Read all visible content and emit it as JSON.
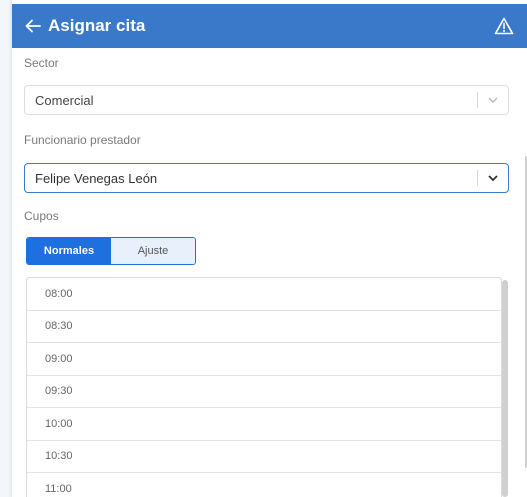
{
  "header": {
    "title": "Asignar cita"
  },
  "sector": {
    "label": "Sector",
    "value": "Comercial"
  },
  "funcionario": {
    "label": "Funcionario prestador",
    "value": "Felipe Venegas León"
  },
  "cupos": {
    "label": "Cupos",
    "tabs": [
      {
        "label": "Normales",
        "active": true
      },
      {
        "label": "Ajuste",
        "active": false
      }
    ],
    "slots": [
      "08:00",
      "08:30",
      "09:00",
      "09:30",
      "10:00",
      "10:30",
      "11:00"
    ]
  },
  "colors": {
    "header": "#3a78c9",
    "accent": "#1e6fe0"
  }
}
